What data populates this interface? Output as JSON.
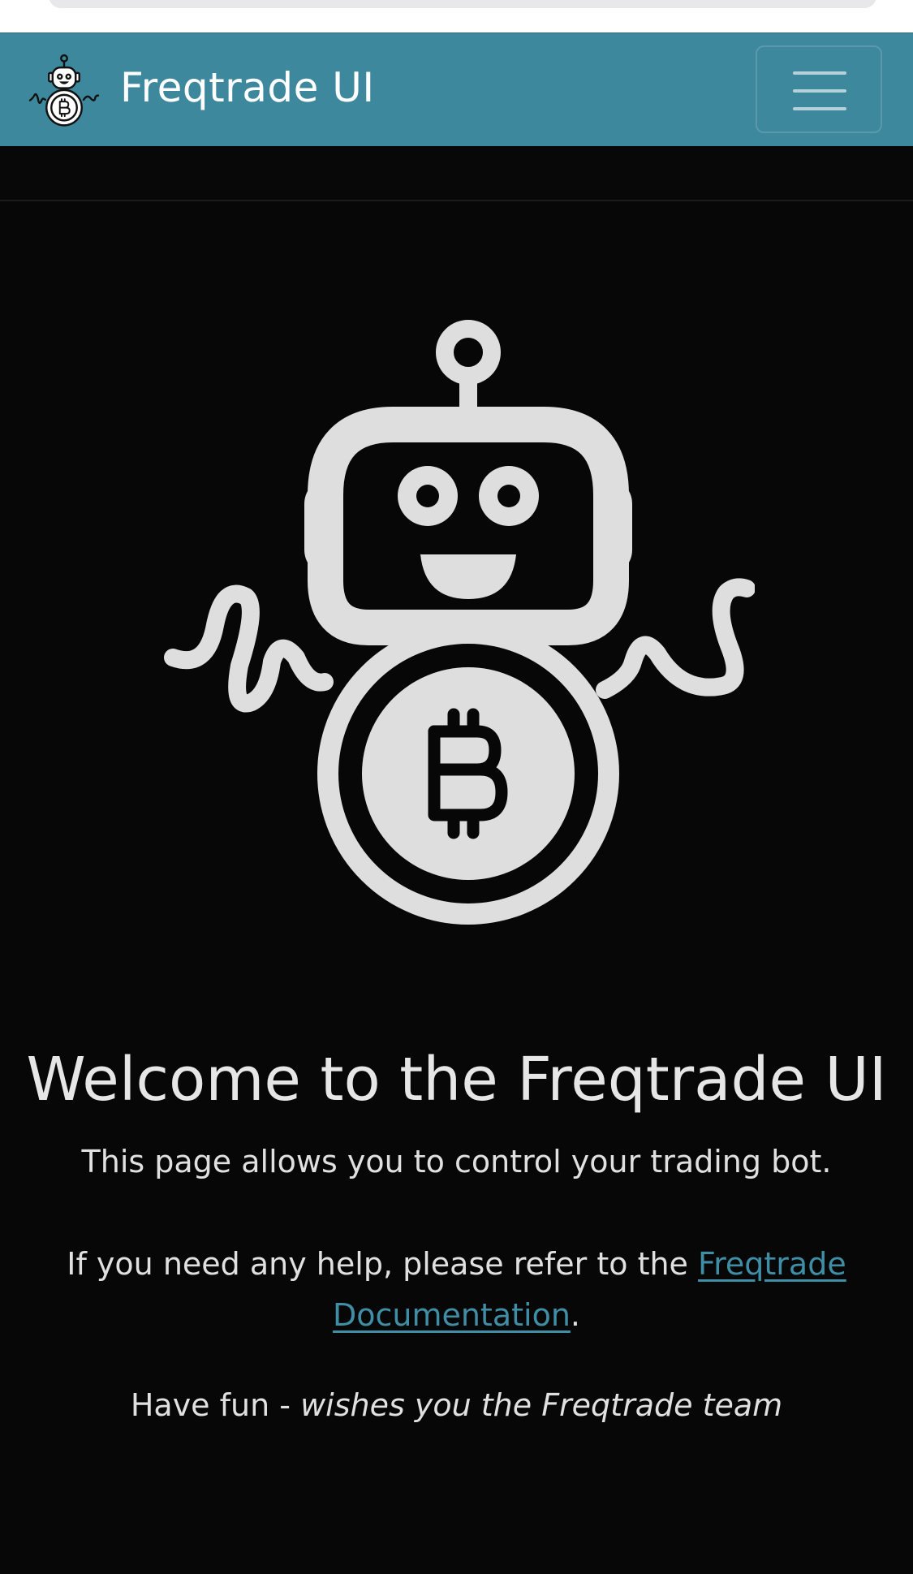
{
  "navbar": {
    "brand": "Freqtrade UI",
    "logo_icon": "freqtrade-robot-bitcoin-icon",
    "toggler_icon": "hamburger-menu-icon",
    "background_color": "#3e889e"
  },
  "hero": {
    "logo_icon": "freqtrade-robot-bitcoin-icon",
    "title": "Welcome to the Freqtrade UI",
    "intro": "This page allows you to control your trading bot.",
    "help_prefix": "If you need any help, please refer to the",
    "help_link": "Freqtrade Documentation",
    "help_suffix": ".",
    "farewell_prefix": "Have fun -",
    "farewell_italic": "wishes you the Freqtrade team"
  },
  "colors": {
    "page_background": "#070707",
    "text": "#e0e0e0",
    "link": "#3f8ea6"
  }
}
